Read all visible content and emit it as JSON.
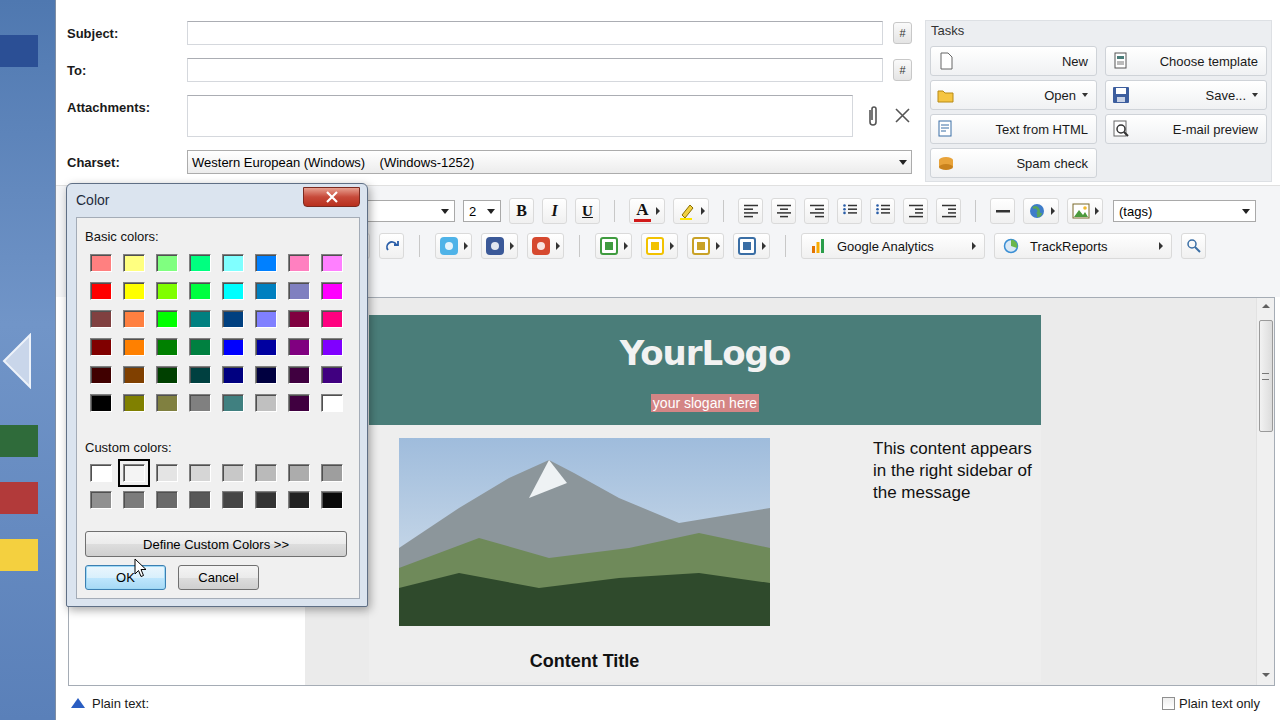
{
  "compose": {
    "hash_button": "#",
    "fields": [
      {
        "kind": "text",
        "label": "Subject:",
        "value": ""
      },
      {
        "kind": "text",
        "label": "To:",
        "value": ""
      },
      {
        "kind": "attachments",
        "label": "Attachments:",
        "value": ""
      },
      {
        "kind": "select",
        "label": "Charset:",
        "value": "Western European (Windows)    (Windows-1252)"
      }
    ]
  },
  "tasks": {
    "title": "Tasks",
    "buttons": [
      {
        "label": "New",
        "dropdown": false
      },
      {
        "label": "Choose template",
        "dropdown": false
      },
      {
        "label": "Open",
        "dropdown": true
      },
      {
        "label": "Save...",
        "dropdown": true
      },
      {
        "label": "Text from HTML",
        "dropdown": false
      },
      {
        "label": "E-mail preview",
        "dropdown": false
      },
      {
        "label": "Spam check",
        "dropdown": false
      }
    ]
  },
  "toolbar": {
    "font_size": "2",
    "format": [
      "B",
      "I",
      "U"
    ],
    "font_color_glyph": "A",
    "tags": "(tags)",
    "analytics": "Google Analytics",
    "track_reports": "TrackReports"
  },
  "editor": {
    "logo": "YourLogo",
    "slogan": "your slogan here",
    "sidebar_text": "This content appears in the right sidebar of the message",
    "content_title": "Content Title"
  },
  "footer": {
    "plain_text_label": "Plain text:",
    "plain_text_only": {
      "label": "Plain text only",
      "checked": false
    }
  },
  "color_dialog": {
    "title": "Color",
    "basic_label": "Basic colors:",
    "basic_colors": [
      {
        "color": "#ff8080",
        "selected": false
      },
      {
        "color": "#ffff80",
        "selected": false
      },
      {
        "color": "#80ff80",
        "selected": false
      },
      {
        "color": "#00ff80",
        "selected": false
      },
      {
        "color": "#80ffff",
        "selected": false
      },
      {
        "color": "#0080ff",
        "selected": false
      },
      {
        "color": "#ff80c0",
        "selected": false
      },
      {
        "color": "#ff80ff",
        "selected": false
      },
      {
        "color": "#ff0000",
        "selected": false
      },
      {
        "color": "#ffff00",
        "selected": false
      },
      {
        "color": "#80ff00",
        "selected": false
      },
      {
        "color": "#00ff40",
        "selected": false
      },
      {
        "color": "#00ffff",
        "selected": false
      },
      {
        "color": "#0080c0",
        "selected": false
      },
      {
        "color": "#8080c0",
        "selected": false
      },
      {
        "color": "#ff00ff",
        "selected": false
      },
      {
        "color": "#804040",
        "selected": false
      },
      {
        "color": "#ff8040",
        "selected": false
      },
      {
        "color": "#00ff00",
        "selected": false
      },
      {
        "color": "#008080",
        "selected": false
      },
      {
        "color": "#004080",
        "selected": false
      },
      {
        "color": "#8080ff",
        "selected": false
      },
      {
        "color": "#800040",
        "selected": false
      },
      {
        "color": "#ff0080",
        "selected": false
      },
      {
        "color": "#800000",
        "selected": false
      },
      {
        "color": "#ff8000",
        "selected": false
      },
      {
        "color": "#008000",
        "selected": false
      },
      {
        "color": "#008040",
        "selected": false
      },
      {
        "color": "#0000ff",
        "selected": false
      },
      {
        "color": "#0000a0",
        "selected": false
      },
      {
        "color": "#800080",
        "selected": false
      },
      {
        "color": "#8000ff",
        "selected": false
      },
      {
        "color": "#400000",
        "selected": false
      },
      {
        "color": "#804000",
        "selected": false
      },
      {
        "color": "#004000",
        "selected": false
      },
      {
        "color": "#004040",
        "selected": false
      },
      {
        "color": "#000080",
        "selected": false
      },
      {
        "color": "#000040",
        "selected": false
      },
      {
        "color": "#400040",
        "selected": false
      },
      {
        "color": "#400080",
        "selected": false
      },
      {
        "color": "#000000",
        "selected": false
      },
      {
        "color": "#808000",
        "selected": false
      },
      {
        "color": "#808040",
        "selected": false
      },
      {
        "color": "#808080",
        "selected": false
      },
      {
        "color": "#408080",
        "selected": false
      },
      {
        "color": "#c0c0c0",
        "selected": false
      },
      {
        "color": "#400040",
        "selected": false
      },
      {
        "color": "#ffffff",
        "selected": false
      }
    ],
    "custom_label": "Custom colors:",
    "custom_colors": [
      {
        "color": "#ffffff",
        "selected": false
      },
      {
        "color": "#f4f4f4",
        "selected": true
      },
      {
        "color": "#e4e4e4",
        "selected": false
      },
      {
        "color": "#d6d6d6",
        "selected": false
      },
      {
        "color": "#c8c8c8",
        "selected": false
      },
      {
        "color": "#bababa",
        "selected": false
      },
      {
        "color": "#acacac",
        "selected": false
      },
      {
        "color": "#9e9e9e",
        "selected": false
      },
      {
        "color": "#909090",
        "selected": false
      },
      {
        "color": "#7c7c7c",
        "selected": false
      },
      {
        "color": "#6a6a6a",
        "selected": false
      },
      {
        "color": "#585858",
        "selected": false
      },
      {
        "color": "#464646",
        "selected": false
      },
      {
        "color": "#343434",
        "selected": false
      },
      {
        "color": "#222222",
        "selected": false
      },
      {
        "color": "#0a0a0a",
        "selected": false
      }
    ],
    "define_button": "Define Custom Colors >>",
    "buttons": [
      {
        "label": "OK",
        "default": true
      },
      {
        "label": "Cancel",
        "default": false
      }
    ]
  }
}
